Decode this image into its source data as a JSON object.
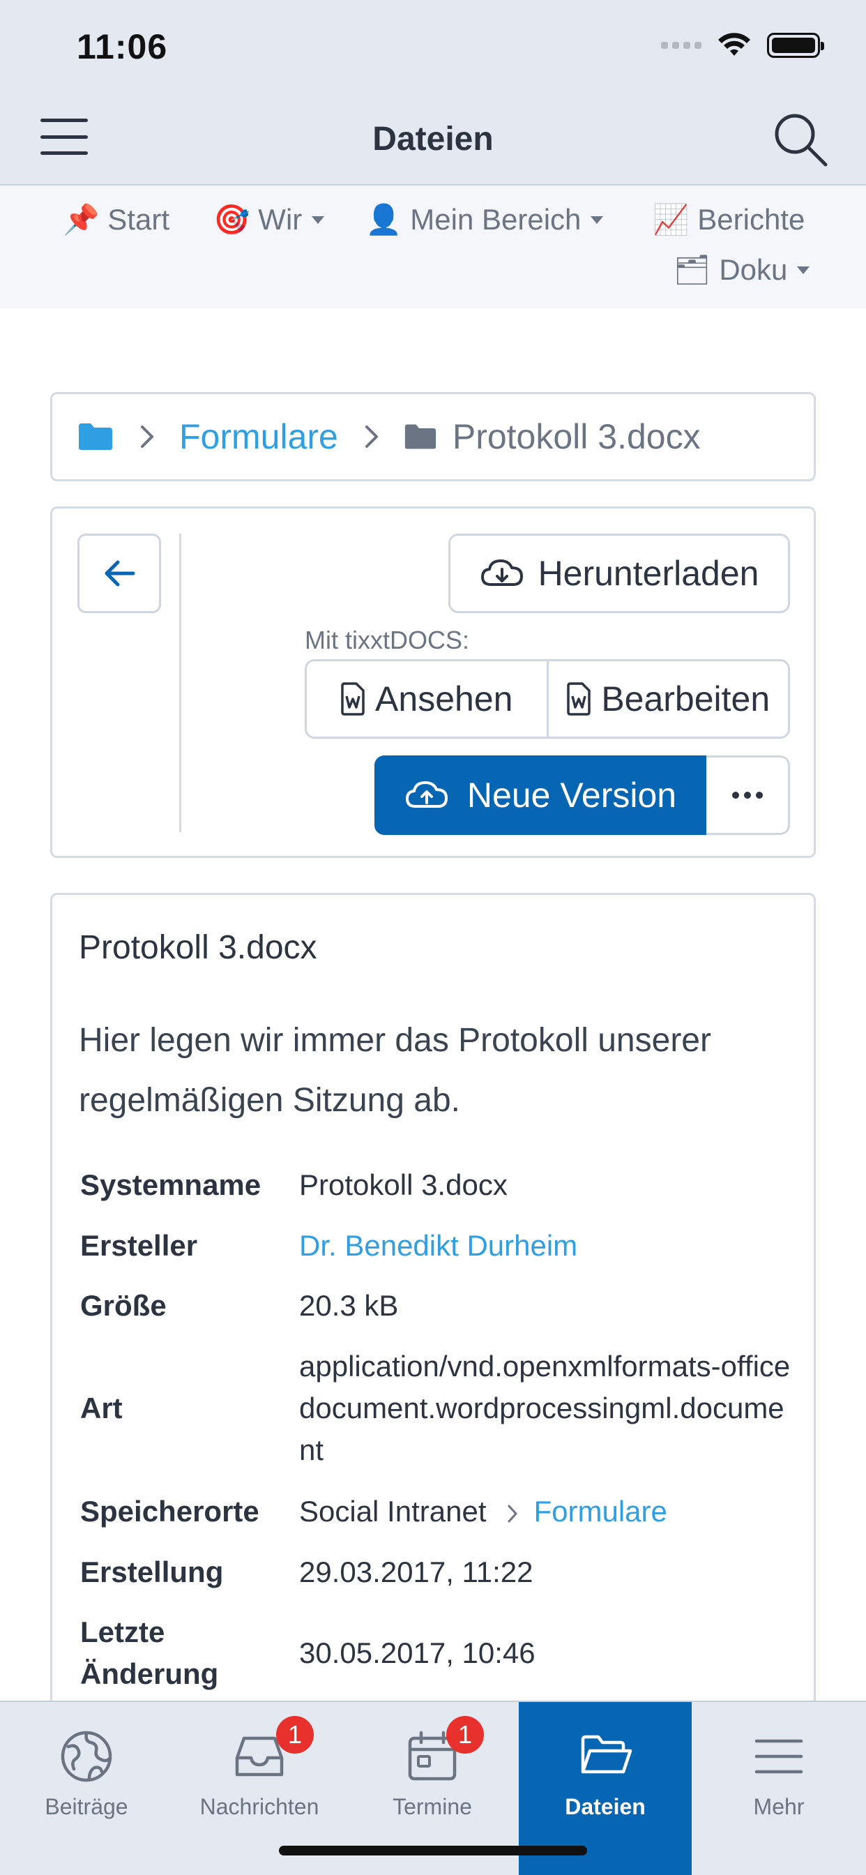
{
  "status": {
    "time": "11:06"
  },
  "header": {
    "title": "Dateien"
  },
  "nav": {
    "items": [
      {
        "icon": "pushpin-icon",
        "emoji": "📌",
        "label": "Start",
        "dropdown": false
      },
      {
        "icon": "target-icon",
        "emoji": "🎯",
        "label": "Wir",
        "dropdown": true
      },
      {
        "icon": "person-icon",
        "emoji": "👤",
        "label": "Mein Bereich",
        "dropdown": true
      },
      {
        "icon": "chart-icon",
        "emoji": "📈",
        "label": "Berichte",
        "dropdown": false
      },
      {
        "icon": "box-icon",
        "emoji": "🗂",
        "label": "Doku",
        "dropdown": true
      }
    ]
  },
  "breadcrumb": {
    "folder_link": "Formulare",
    "current": "Protokoll 3.docx"
  },
  "actions": {
    "download_label": "Herunterladen",
    "tixxt_label": "Mit tixxtDOCS:",
    "view_label": "Ansehen",
    "edit_label": "Bearbeiten",
    "new_version_label": "Neue Version"
  },
  "file": {
    "title": "Protokoll 3.docx",
    "description": "Hier legen wir immer das Protokoll unserer regelmäßigen Sitzung ab.",
    "props": {
      "systemname_key": "Systemname",
      "systemname": "Protokoll 3.docx",
      "creator_key": "Ersteller",
      "creator": "Dr. Benedikt Durheim",
      "size_key": "Größe",
      "size": "20.3 kB",
      "type_key": "Art",
      "type": "application/vnd.openxmlformats-officedocument.wordprocessingml.document",
      "locations_key": "Speicherorte",
      "location_root": "Social Intranet",
      "location_folder": "Formulare",
      "created_key": "Erstellung",
      "created": "29.03.2017, 11:22",
      "modified_key": "Letzte Änderung",
      "modified": "30.05.2017, 10:46"
    }
  },
  "tabbar": {
    "tabs": [
      {
        "label": "Beiträge",
        "icon": "globe-icon",
        "badge": null,
        "active": false
      },
      {
        "label": "Nachrichten",
        "icon": "inbox-icon",
        "badge": "1",
        "active": false
      },
      {
        "label": "Termine",
        "icon": "calendar-icon",
        "badge": "1",
        "active": false
      },
      {
        "label": "Dateien",
        "icon": "folder-open-icon",
        "badge": null,
        "active": true
      },
      {
        "label": "Mehr",
        "icon": "menu-icon",
        "badge": null,
        "active": false
      }
    ]
  },
  "colors": {
    "primary": "#0666b3",
    "link": "#2f9fe3",
    "badge": "#e8312c",
    "bar_bg": "#e4e9f1"
  }
}
